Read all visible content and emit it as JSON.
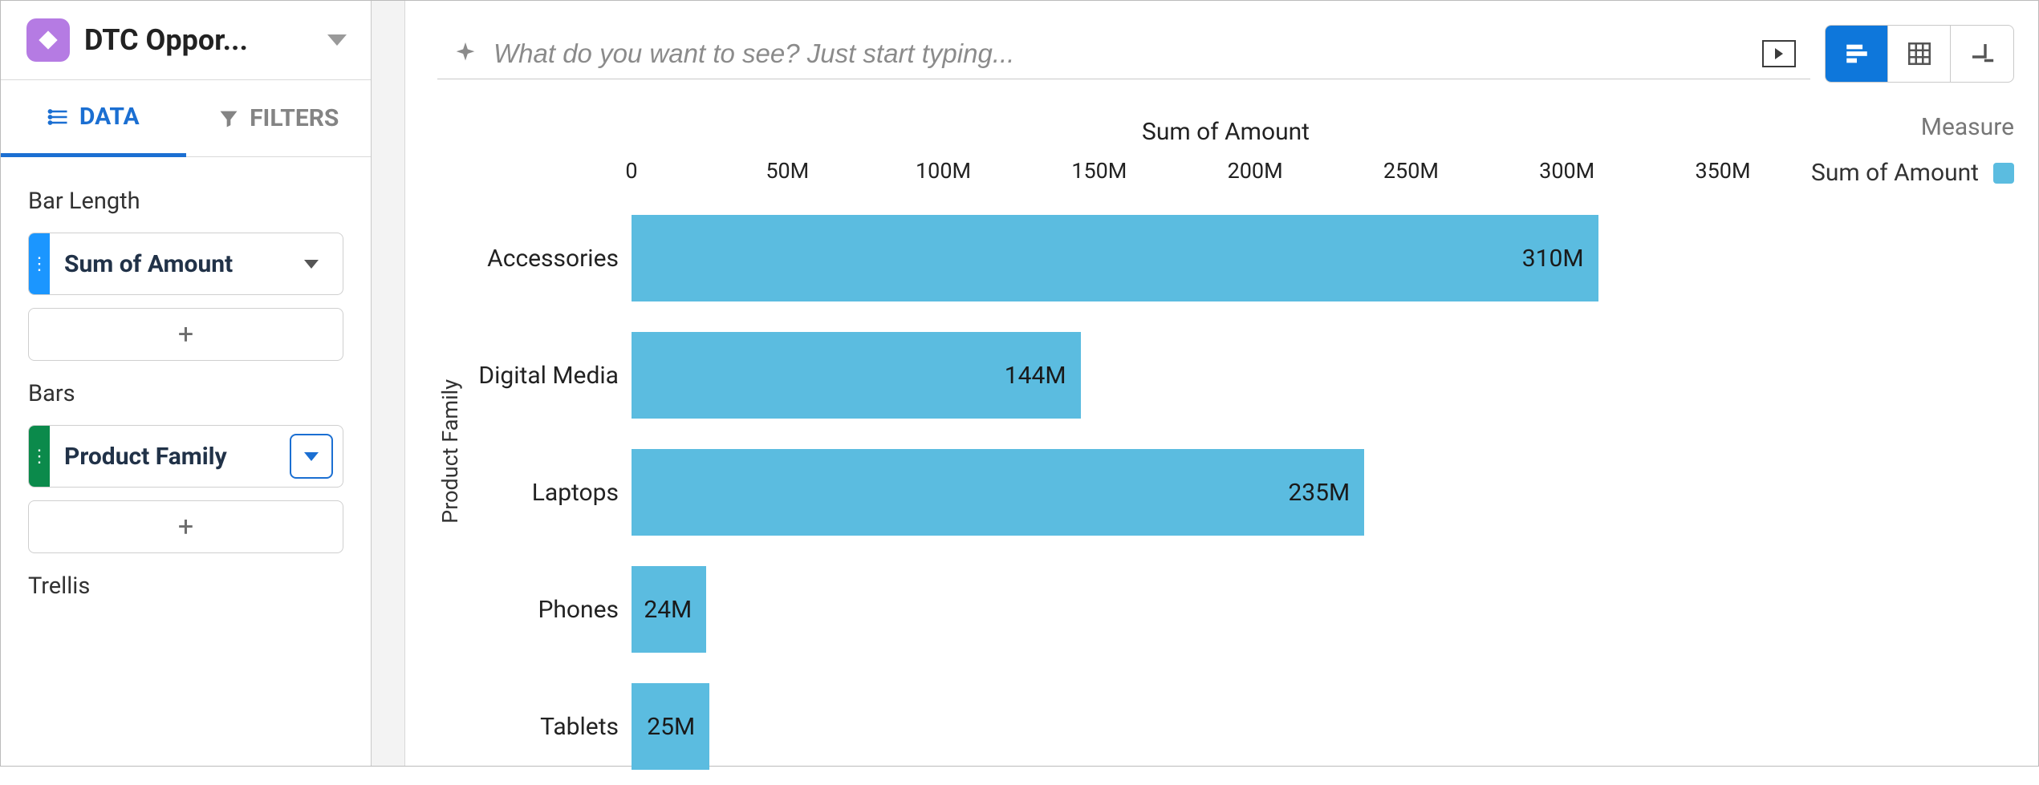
{
  "dataset": {
    "title": "DTC Oppor..."
  },
  "tabs": {
    "data": "DATA",
    "filters": "FILTERS"
  },
  "panel": {
    "bar_length_label": "Bar Length",
    "measure_pill": "Sum of Amount",
    "bars_label": "Bars",
    "dimension_pill": "Product Family",
    "trellis_label": "Trellis",
    "add_symbol": "+"
  },
  "query": {
    "placeholder": "What do you want to see? Just start typing..."
  },
  "legend": {
    "title": "Measure",
    "item": "Sum of Amount"
  },
  "chart_data": {
    "type": "bar",
    "orientation": "horizontal",
    "title": "Sum of Amount",
    "xlabel": "Sum of Amount",
    "ylabel": "Product Family",
    "categories": [
      "Accessories",
      "Digital Media",
      "Laptops",
      "Phones",
      "Tablets"
    ],
    "values": [
      310000000,
      144000000,
      235000000,
      24000000,
      25000000
    ],
    "value_labels": [
      "310M",
      "144M",
      "235M",
      "24M",
      "25M"
    ],
    "xlim": [
      0,
      350000000
    ],
    "x_ticks": [
      0,
      50000000,
      100000000,
      150000000,
      200000000,
      250000000,
      300000000,
      350000000
    ],
    "x_tick_labels": [
      "0",
      "50M",
      "100M",
      "150M",
      "200M",
      "250M",
      "300M",
      "350M"
    ],
    "series": [
      {
        "name": "Sum of Amount",
        "color": "#5bbce0"
      }
    ]
  }
}
